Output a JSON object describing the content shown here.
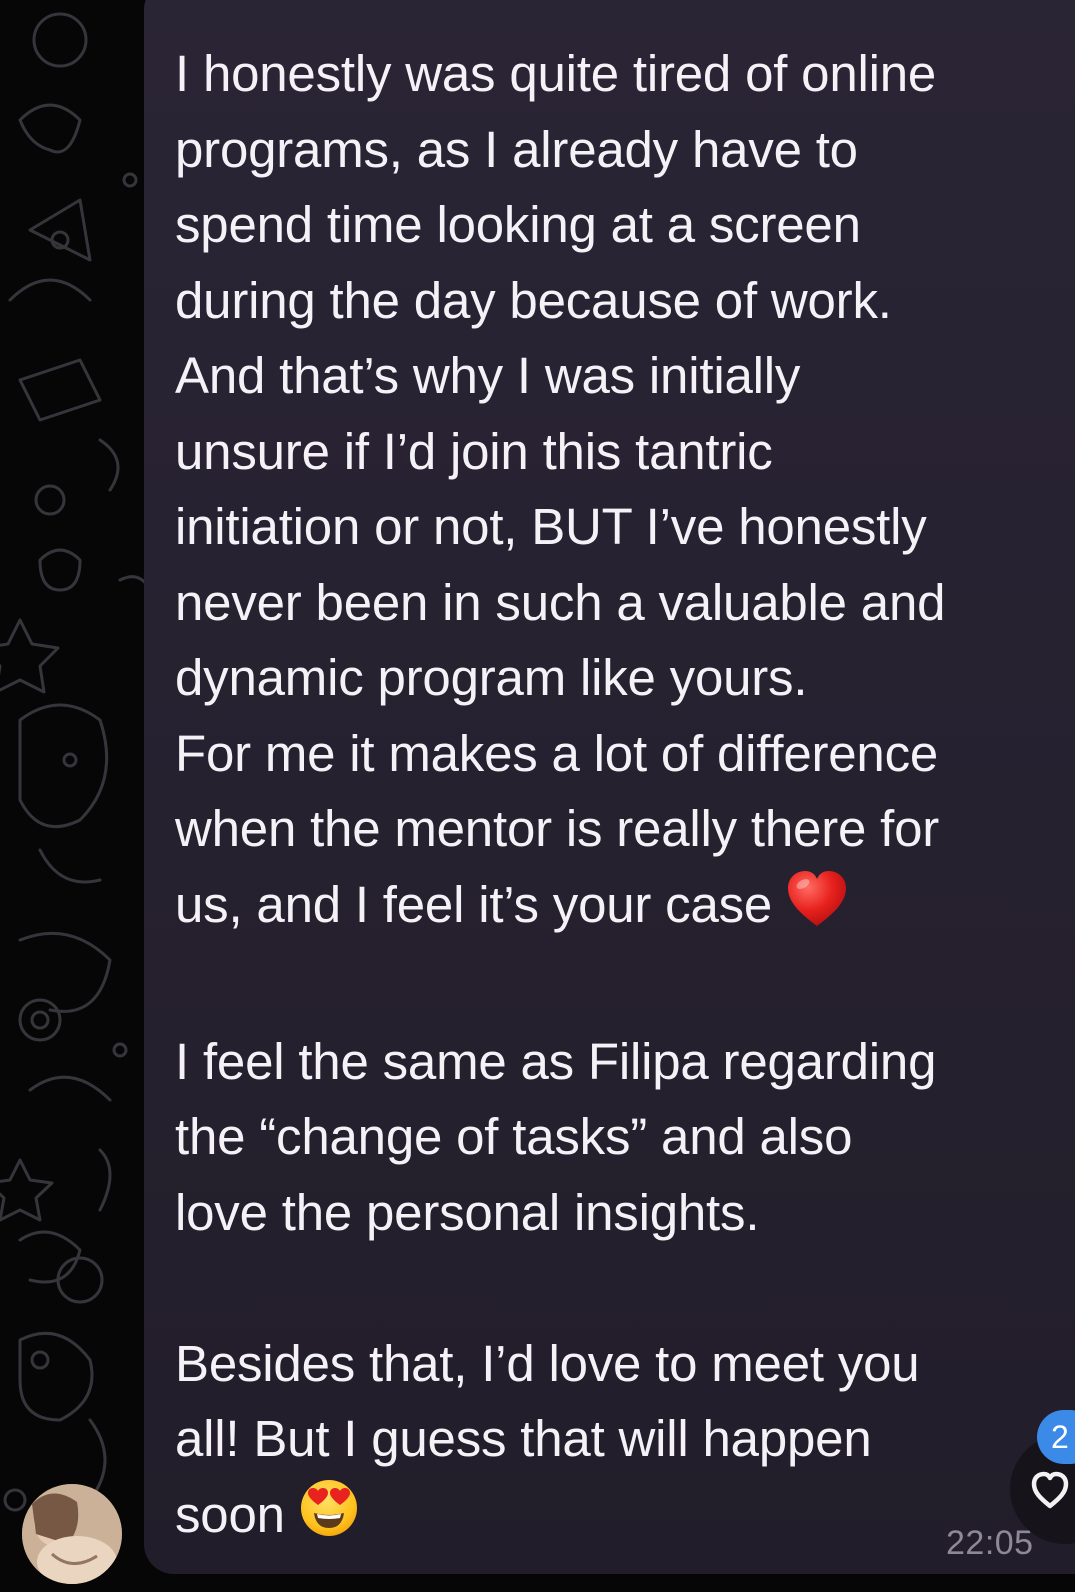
{
  "message": {
    "lines": [
      "I honestly was quite tired of online",
      "programs, as I already have to",
      "spend time looking at a screen",
      "during the day because of work.",
      "And that’s why I was initially",
      "unsure if I’d join this tantric",
      "initiation or not, BUT I’ve honestly",
      "never been in such a valuable and",
      "dynamic program like yours.",
      "For me it makes a lot of difference",
      "when the mentor is really there for",
      "us, and I feel it’s your case",
      "",
      "I feel the same as Filipa regarding",
      "the “change of tasks” and also",
      "love the personal insights.",
      "",
      "Besides that, I’d love to meet you",
      "all! But I guess that will happen",
      "soon"
    ],
    "time": "22:05"
  },
  "unread_badge": "2",
  "icons": {
    "heart_emoji": "red-heart-emoji-icon",
    "heart_eyes_emoji": "smiling-face-with-heart-eyes-emoji-icon",
    "reaction": "heart-reaction-icon"
  },
  "colors": {
    "bubble": "#27222f",
    "text": "#f4f2f7",
    "time": "#8e8899",
    "badge": "#3b8ae8"
  }
}
